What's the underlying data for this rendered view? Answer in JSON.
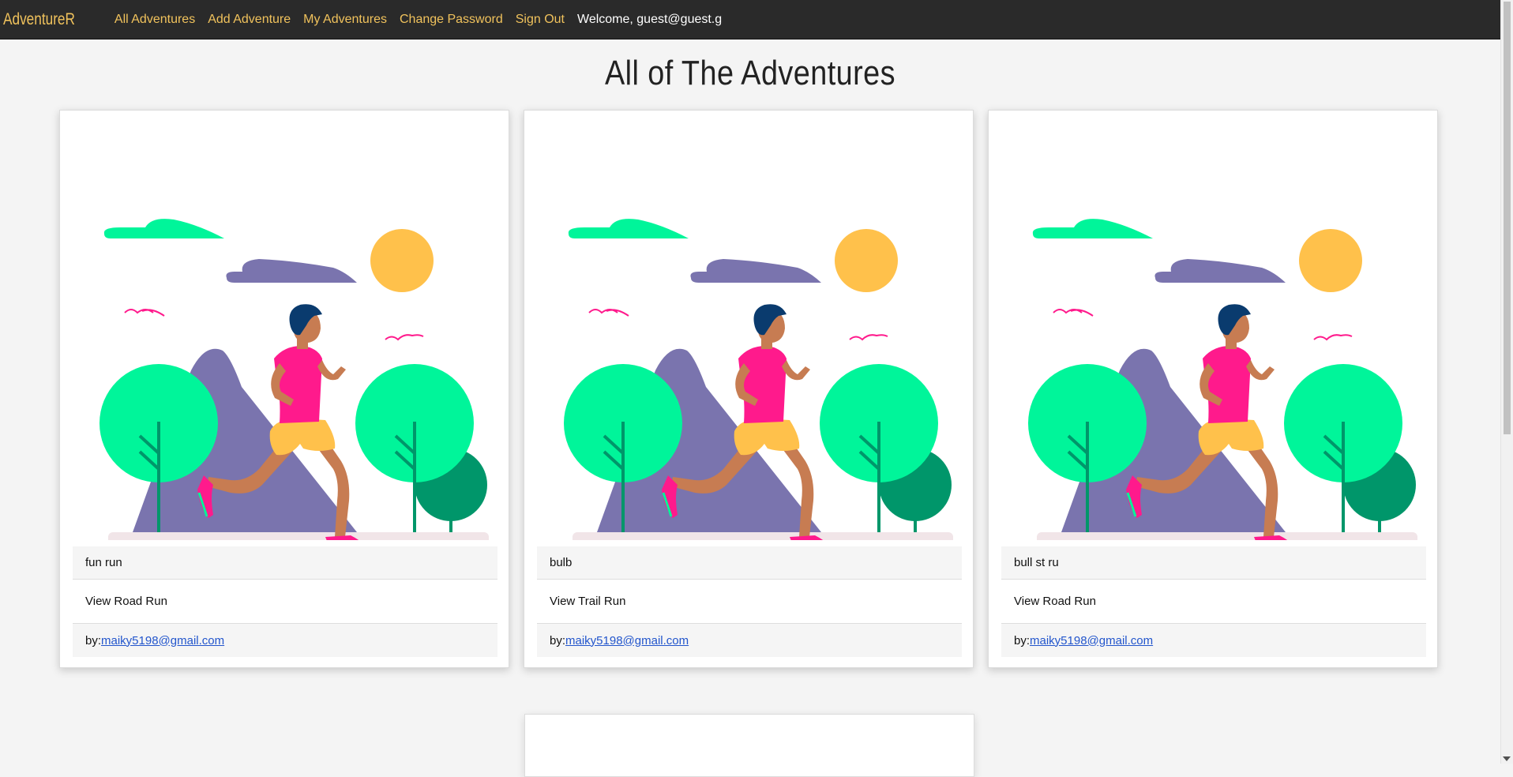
{
  "navbar": {
    "brand": "AdventureR",
    "links": [
      "All Adventures",
      "Add Adventure",
      "My Adventures",
      "Change Password",
      "Sign Out"
    ],
    "welcome": "Welcome, guest@guest.g"
  },
  "page": {
    "title": "All of The Adventures"
  },
  "cards": [
    {
      "title": "fun run",
      "view_label": "View Road Run",
      "by_label": "by:",
      "author": "maiky5198@gmail.com"
    },
    {
      "title": "bulb",
      "view_label": "View Trail Run",
      "by_label": "by:",
      "author": "maiky5198@gmail.com"
    },
    {
      "title": "bull st ru",
      "view_label": "View Road Run",
      "by_label": "by:",
      "author": "maiky5198@gmail.com"
    }
  ],
  "colors": {
    "navbar_bg": "#2a2a2a",
    "nav_link": "#f0c25c",
    "link_blue": "#2255cc",
    "tree_light": "#00f59a",
    "tree_dark": "#00966a",
    "mountain": "#7a74ae",
    "sun": "#ffc14b",
    "shirt": "#ff1a8c"
  }
}
